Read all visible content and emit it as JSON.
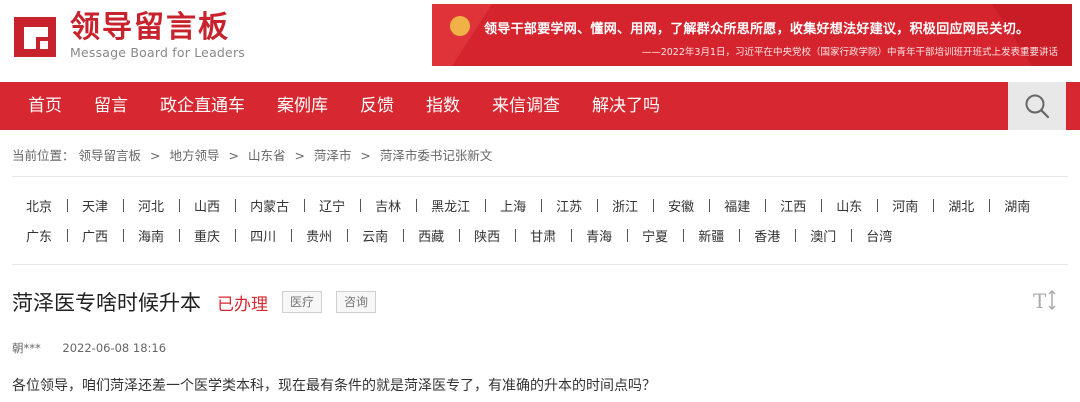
{
  "logo": {
    "title_cn": "领导留言板",
    "title_en": "Message Board for Leaders",
    "icon": "logo-mark"
  },
  "banner": {
    "main": "领导干部要学网、懂网、用网，了解群众所思所愿，收集好想法好建议，积极回应网民关切。",
    "sub": "——2022年3月1日，习近平在中央党校（国家行政学院）中青年干部培训班开班式上发表重要讲话",
    "color": "#d5242e"
  },
  "nav": {
    "items": [
      "首页",
      "留言",
      "政企直通车",
      "案例库",
      "反馈",
      "指数",
      "来信调查",
      "解决了吗"
    ],
    "search_icon": "search-icon",
    "color": "#d72730"
  },
  "breadcrumb": {
    "prefix": "当前位置：",
    "items": [
      "领导留言板",
      "地方领导",
      "山东省",
      "菏泽市",
      "菏泽市委书记张新文"
    ],
    "separator": ">"
  },
  "regions": {
    "row1": [
      "北京",
      "天津",
      "河北",
      "山西",
      "内蒙古",
      "辽宁",
      "吉林",
      "黑龙江",
      "上海",
      "江苏",
      "浙江",
      "安徽",
      "福建",
      "江西",
      "山东",
      "河南",
      "湖北",
      "湖南"
    ],
    "row2": [
      "广东",
      "广西",
      "海南",
      "重庆",
      "四川",
      "贵州",
      "云南",
      "西藏",
      "陕西",
      "甘肃",
      "青海",
      "宁夏",
      "新疆",
      "香港",
      "澳门",
      "台湾"
    ]
  },
  "post": {
    "title": "菏泽医专啥时候升本",
    "status": "已办理",
    "tags": [
      "医疗",
      "咨询"
    ],
    "author": "朝***",
    "time": "2022-06-08 18:16",
    "content": "各位领导，咱们菏泽还差一个医学类本科，现在最有条件的就是菏泽医专了，有准确的升本的时间点吗？",
    "font_toggle_icon": "font-size-toggle-icon",
    "status_color": "#d72730"
  }
}
